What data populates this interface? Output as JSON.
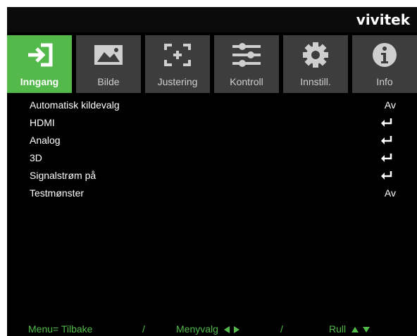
{
  "brand": "vivitek",
  "colors": {
    "accent": "#52b94a",
    "tab_bg": "#3d3d3d",
    "background": "#000000",
    "text": "#ffffff"
  },
  "tabs": [
    {
      "label": "Inngang",
      "icon": "input-icon",
      "active": true
    },
    {
      "label": "Bilde",
      "icon": "picture-icon",
      "active": false
    },
    {
      "label": "Justering",
      "icon": "adjust-frame-icon",
      "active": false
    },
    {
      "label": "Kontroll",
      "icon": "sliders-icon",
      "active": false
    },
    {
      "label": "Innstill.",
      "icon": "gear-icon",
      "active": false
    },
    {
      "label": "Info",
      "icon": "info-icon",
      "active": false
    }
  ],
  "menu": [
    {
      "label": "Automatisk kildevalg",
      "value": "Av"
    },
    {
      "label": "HDMI",
      "value": null,
      "icon": "enter-icon"
    },
    {
      "label": "Analog",
      "value": null,
      "icon": "enter-icon"
    },
    {
      "label": "3D",
      "value": null,
      "icon": "enter-icon"
    },
    {
      "label": "Signalstrøm på",
      "value": null,
      "icon": "enter-icon"
    },
    {
      "label": "Testmønster",
      "value": "Av"
    }
  ],
  "footer": {
    "back": "Menu= Tilbake",
    "sep": "/",
    "select": "Menyvalg",
    "scroll": "Rull"
  }
}
